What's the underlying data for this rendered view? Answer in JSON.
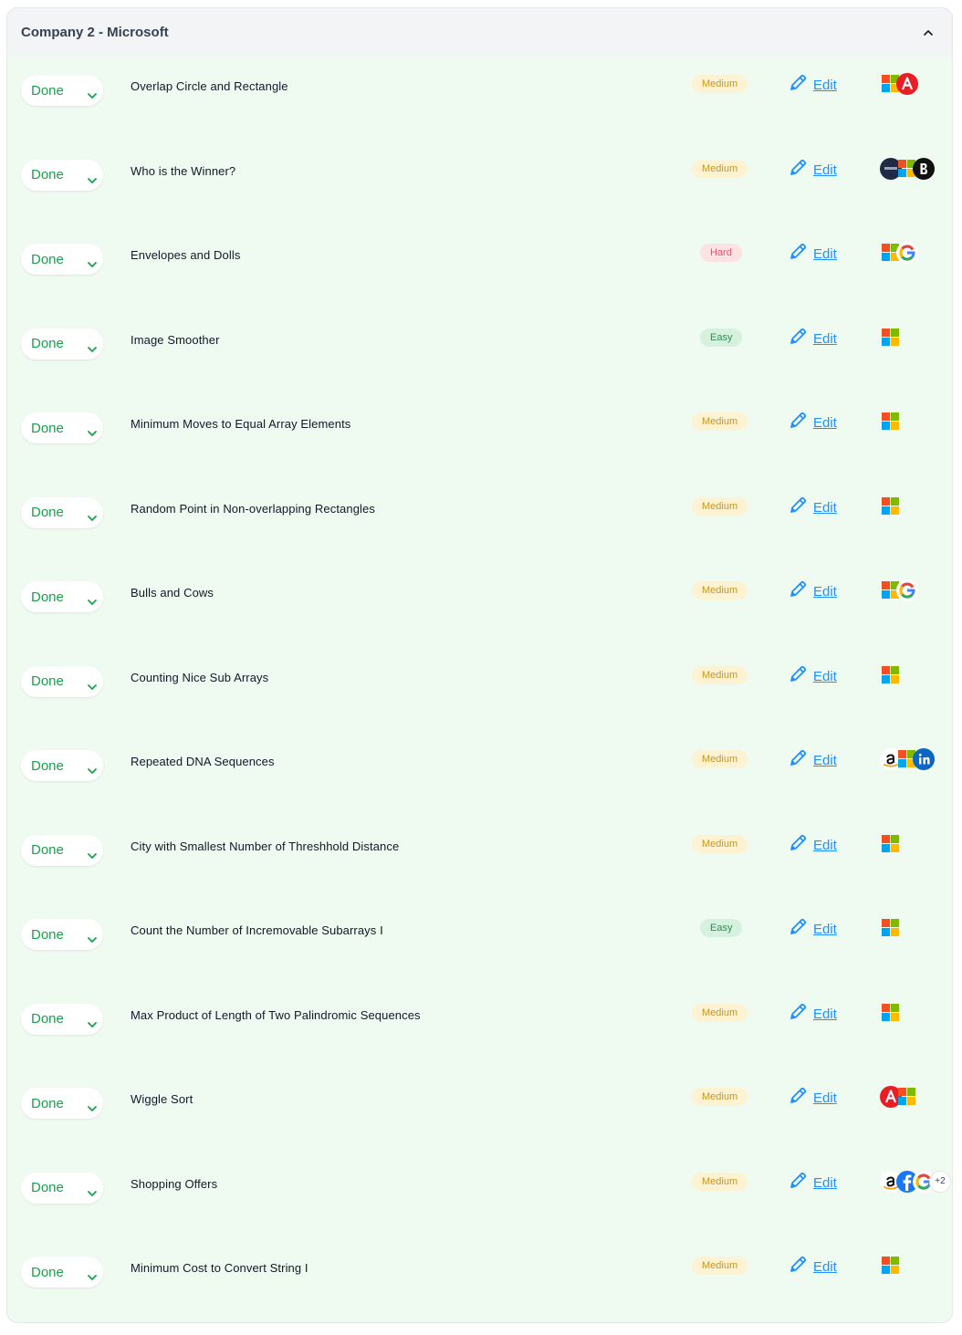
{
  "panel": {
    "title": "Company 2 - Microsoft"
  },
  "colors": {
    "done": "#16a34a",
    "edit": "#1e90ff",
    "medium_bg": "#fdf3d3",
    "hard_bg": "#fde2e4",
    "easy_bg": "#d6f2de"
  },
  "rows": [
    {
      "status": "Done",
      "name": "Overlap Circle and Rectangle",
      "difficulty": "Medium",
      "edit": "Edit",
      "companies": [
        "microsoft",
        "adobe"
      ]
    },
    {
      "status": "Done",
      "name": "Who is the Winner?",
      "difficulty": "Medium",
      "edit": "Edit",
      "companies": [
        "bloomberg",
        "microsoft",
        "bytedance"
      ]
    },
    {
      "status": "Done",
      "name": "Envelopes and Dolls",
      "difficulty": "Hard",
      "edit": "Edit",
      "companies": [
        "microsoft",
        "google"
      ]
    },
    {
      "status": "Done",
      "name": "Image Smoother",
      "difficulty": "Easy",
      "edit": "Edit",
      "companies": [
        "microsoft"
      ]
    },
    {
      "status": "Done",
      "name": "Minimum Moves to Equal Array Elements",
      "difficulty": "Medium",
      "edit": "Edit",
      "companies": [
        "microsoft"
      ]
    },
    {
      "status": "Done",
      "name": "Random Point in Non-overlapping Rectangles",
      "difficulty": "Medium",
      "edit": "Edit",
      "companies": [
        "microsoft"
      ]
    },
    {
      "status": "Done",
      "name": "Bulls and Cows",
      "difficulty": "Medium",
      "edit": "Edit",
      "companies": [
        "microsoft",
        "google"
      ]
    },
    {
      "status": "Done",
      "name": "Counting Nice Sub Arrays",
      "difficulty": "Medium",
      "edit": "Edit",
      "companies": [
        "microsoft"
      ]
    },
    {
      "status": "Done",
      "name": "Repeated DNA Sequences",
      "difficulty": "Medium",
      "edit": "Edit",
      "companies": [
        "amazon",
        "microsoft",
        "linkedin"
      ]
    },
    {
      "status": "Done",
      "name": "City with Smallest Number of Threshhold Distance",
      "difficulty": "Medium",
      "edit": "Edit",
      "companies": [
        "microsoft"
      ]
    },
    {
      "status": "Done",
      "name": "Count the Number of Incremovable Subarrays I",
      "difficulty": "Easy",
      "edit": "Edit",
      "companies": [
        "microsoft"
      ]
    },
    {
      "status": "Done",
      "name": "Max Product of Length of Two Palindromic Sequences",
      "difficulty": "Medium",
      "edit": "Edit",
      "companies": [
        "microsoft"
      ]
    },
    {
      "status": "Done",
      "name": "Wiggle Sort",
      "difficulty": "Medium",
      "edit": "Edit",
      "companies": [
        "adobe",
        "microsoft"
      ]
    },
    {
      "status": "Done",
      "name": "Shopping Offers",
      "difficulty": "Medium",
      "edit": "Edit",
      "companies": [
        "amazon",
        "facebook",
        "google"
      ],
      "more": "+2"
    },
    {
      "status": "Done",
      "name": "Minimum Cost to Convert String I",
      "difficulty": "Medium",
      "edit": "Edit",
      "companies": [
        "microsoft"
      ]
    }
  ]
}
